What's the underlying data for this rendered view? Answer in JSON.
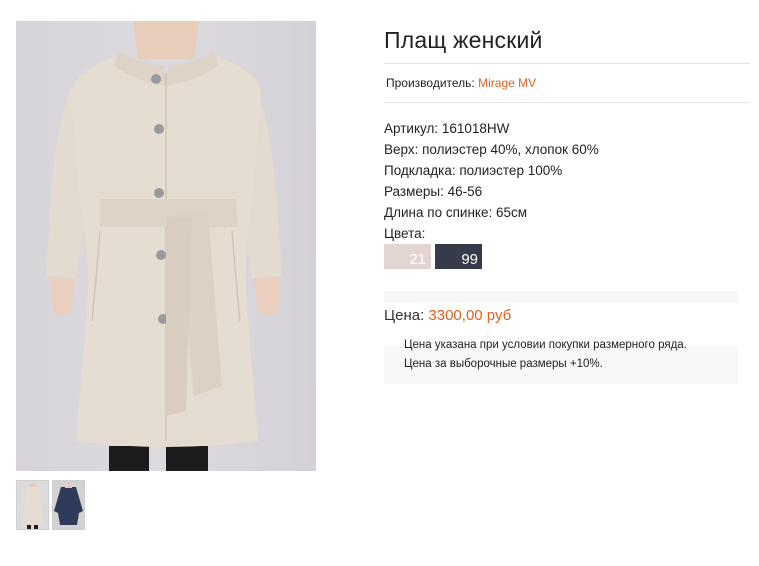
{
  "product": {
    "title": "Плащ женский",
    "maker_label": "Производитель:",
    "maker_name": "Mirage MV",
    "specs": [
      "Артикул: 161018HW",
      "Верх: полиэстер 40%, хлопок 60%",
      "Подкладка: полиэстер 100%",
      "Размеры: 46-56",
      "Длина по спинке: 65см",
      "Цвета:"
    ],
    "colors": [
      {
        "code": "21",
        "hex": "#e3d6d2"
      },
      {
        "code": "99",
        "hex": "#373b49"
      }
    ],
    "price_label": "Цена:",
    "price_value": "3300,00 руб",
    "notes": [
      "Цена указана при условии покупки размерного ряда.",
      "Цена за выборочные размеры +10%."
    ]
  },
  "gallery": {
    "main_image": "beige-trench-coat-photo",
    "thumbnails": [
      "beige-coat-thumbnail",
      "navy-coat-thumbnail"
    ]
  },
  "theme": {
    "accent": "#e0601f",
    "coat_beige": "#e6ddd2",
    "coat_navy": "#2f3b5a"
  }
}
